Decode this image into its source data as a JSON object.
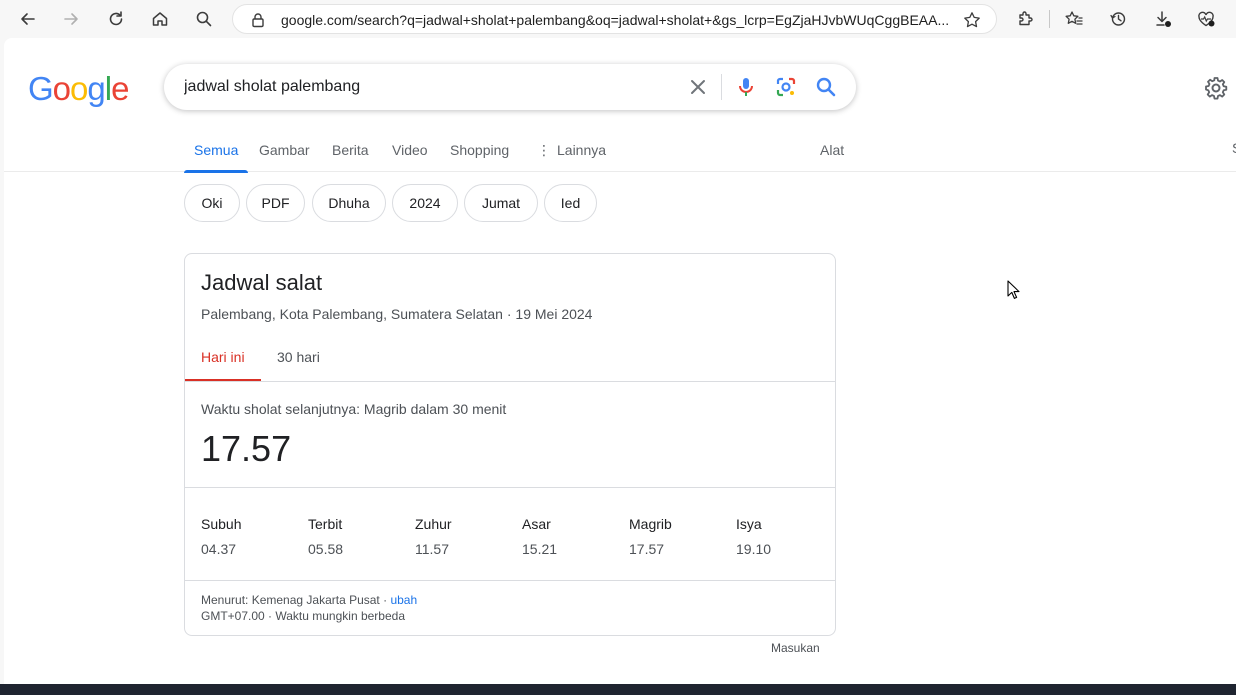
{
  "browser": {
    "url": "google.com/search?q=jadwal+sholat+palembang&oq=jadwal+sholat+&gs_lcrp=EgZjaHJvbWUqCggBEAA..."
  },
  "google": {
    "logo_letters": [
      {
        "ch": "G",
        "color": "#4285F4"
      },
      {
        "ch": "o",
        "color": "#EA4335"
      },
      {
        "ch": "o",
        "color": "#FBBC05"
      },
      {
        "ch": "g",
        "color": "#4285F4"
      },
      {
        "ch": "l",
        "color": "#34A853"
      },
      {
        "ch": "e",
        "color": "#EA4335"
      }
    ],
    "search_query": "jadwal sholat palembang"
  },
  "tabs": {
    "semua": "Semua",
    "gambar": "Gambar",
    "berita": "Berita",
    "video": "Video",
    "shopping": "Shopping",
    "lainnya": "Lainnya",
    "alat": "Alat",
    "right_cut": "S"
  },
  "chips": [
    "Oki",
    "PDF",
    "Dhuha",
    "2024",
    "Jumat",
    "Ied"
  ],
  "card": {
    "title": "Jadwal salat",
    "subtitle": "Palembang, Kota Palembang, Sumatera Selatan · 19 Mei 2024",
    "tab_today": "Hari ini",
    "tab_30": "30 hari",
    "next_label": "Waktu sholat selanjutnya: Magrib dalam 30 menit",
    "next_time": "17.57",
    "prayers": [
      {
        "name": "Subuh",
        "time": "04.37"
      },
      {
        "name": "Terbit",
        "time": "05.58"
      },
      {
        "name": "Zuhur",
        "time": "11.57"
      },
      {
        "name": "Asar",
        "time": "15.21"
      },
      {
        "name": "Magrib",
        "time": "17.57"
      },
      {
        "name": "Isya",
        "time": "19.10"
      }
    ],
    "source_prefix": "Menurut: Kemenag Jakarta Pusat · ",
    "source_link": "ubah",
    "timezone": "GMT+07.00 · Waktu mungkin berbeda"
  },
  "feedback": "Masukan",
  "colors": {
    "accent": "#1a73e8",
    "active_tab_red": "#d93025"
  }
}
